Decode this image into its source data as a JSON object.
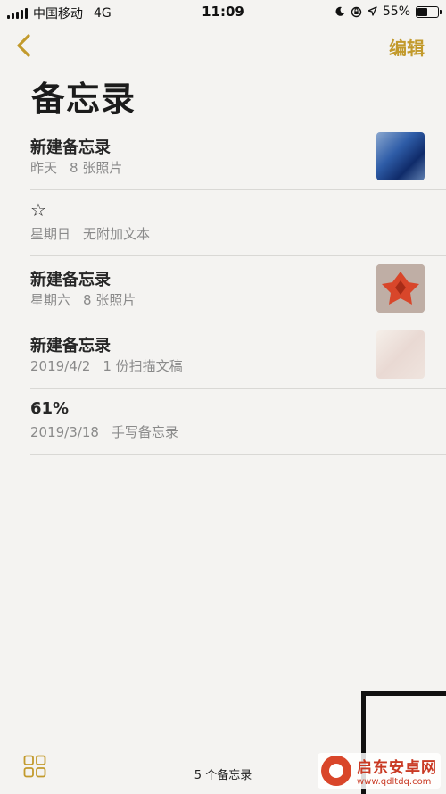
{
  "status_bar": {
    "carrier": "中国移动",
    "network": "4G",
    "time": "11:09",
    "battery_percent": "55%",
    "battery_level": 0.55,
    "icons": [
      "moon-icon",
      "orientation-lock-icon",
      "location-icon"
    ]
  },
  "nav": {
    "back_icon": "chevron-left-icon",
    "edit_label": "编辑"
  },
  "page_title": "备忘录",
  "notes": [
    {
      "title": "新建备忘录",
      "date": "昨天",
      "detail": "8 张照片",
      "thumbnail": "photo-blue"
    },
    {
      "title": "☆",
      "date": "星期日",
      "detail": "无附加文本",
      "thumbnail": ""
    },
    {
      "title": "新建备忘录",
      "date": "星期六",
      "detail": "8 张照片",
      "thumbnail": "photo-red-origami"
    },
    {
      "title": "新建备忘录",
      "date": "2019/4/2",
      "detail": "1 份扫描文稿",
      "thumbnail": "scan"
    },
    {
      "title": "61%",
      "date": "2019/3/18",
      "detail": "手写备忘录",
      "thumbnail": ""
    }
  ],
  "toolbar": {
    "grid_icon": "gallery-grid-icon",
    "count_label": "5 个备忘录"
  },
  "watermark": {
    "name": "启东安卓网",
    "url": "www.qdltdq.com"
  },
  "colors": {
    "accent": "#c29a2c",
    "background": "#f4f3f1",
    "secondary_text": "#8a8a8a"
  }
}
